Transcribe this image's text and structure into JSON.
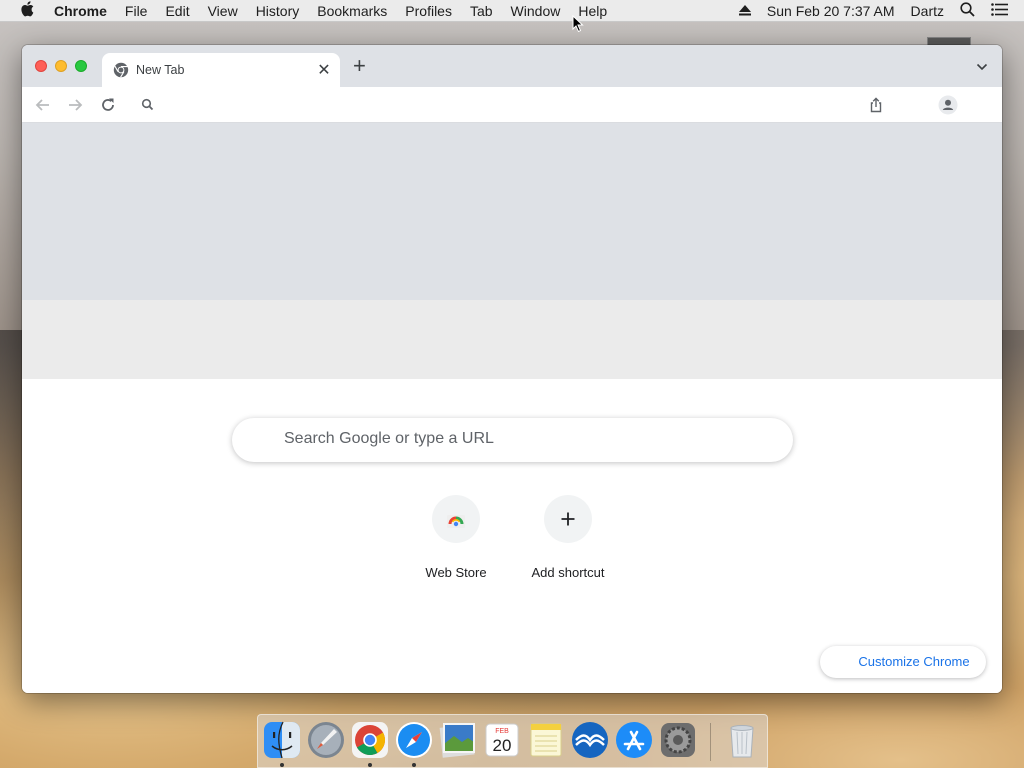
{
  "menubar": {
    "app": "Chrome",
    "items": [
      "File",
      "Edit",
      "View",
      "History",
      "Bookmarks",
      "Profiles",
      "Tab",
      "Window",
      "Help"
    ],
    "clock": "Sun Feb 20  7:37 AM",
    "user": "Dartz"
  },
  "browser": {
    "tab_title": "New Tab",
    "new_tab_symbol": "+",
    "close_symbol": "✕"
  },
  "ntp": {
    "search_placeholder": "Search Google or type a URL",
    "shortcuts": [
      {
        "label": "Web Store",
        "icon": "webstore-icon"
      },
      {
        "label": "Add shortcut",
        "icon": "plus-icon"
      }
    ],
    "customize_label": "Customize Chrome"
  },
  "dock": {
    "apps": [
      "finder-icon",
      "launchpad-icon",
      "chrome-icon",
      "safari-icon",
      "photos-icon",
      "calendar-icon",
      "notes-icon",
      "mail-icon",
      "app-store-icon",
      "system-preferences-icon",
      "trash-icon"
    ],
    "calendar_month": "FEB",
    "calendar_day": "20"
  },
  "colors": {
    "accent": "#1a73e8",
    "tabstrip": "#dee1e6"
  }
}
